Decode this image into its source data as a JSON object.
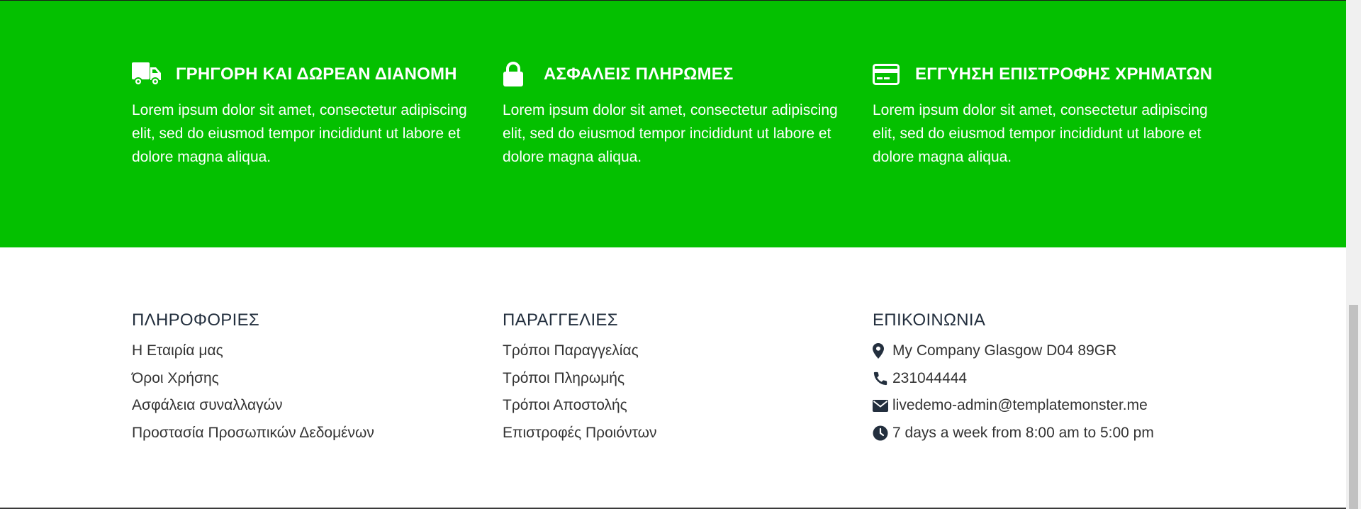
{
  "colors": {
    "features_bg": "#04c000",
    "footer_bg": "#ffffff",
    "text_dark": "#232f3e"
  },
  "features": [
    {
      "icon": "truck-icon",
      "title": "ΓΡΗΓΟΡΗ ΚΑΙ ΔΩΡΕΑΝ ΔΙΑΝΟΜΗ",
      "text": "Lorem ipsum dolor sit amet, consectetur adipiscing elit, sed do eiusmod tempor incididunt ut labore et dolore magna aliqua."
    },
    {
      "icon": "lock-icon",
      "title": "ΑΣΦΑΛΕΙΣ ΠΛΗΡΩΜΕΣ",
      "text": "Lorem ipsum dolor sit amet, consectetur adipiscing elit, sed do eiusmod tempor incididunt ut labore et dolore magna aliqua."
    },
    {
      "icon": "credit-card-icon",
      "title": "ΕΓΓΥΗΣΗ ΕΠΙΣΤΡΟΦΗΣ ΧΡΗΜΑΤΩΝ",
      "text": "Lorem ipsum dolor sit amet, consectetur adipiscing elit, sed do eiusmod tempor incididunt ut labore et dolore magna aliqua."
    }
  ],
  "footer": {
    "info": {
      "title": "ΠΛΗΡΟΦΟΡΙΕΣ",
      "links": [
        "Η Εταιρία μας",
        "Όροι Χρήσης",
        "Ασφάλεια συναλλαγών",
        "Προστασία Προσωπικών Δεδομένων"
      ]
    },
    "orders": {
      "title": "ΠΑΡΑΓΓΕΛΙΕΣ",
      "links": [
        "Τρόποι Παραγγελίας",
        "Τρόποι Πληρωμής",
        "Τρόποι Αποστολής",
        "Επιστροφές Προιόντων"
      ]
    },
    "contact": {
      "title": "ΕΠΙΚΟΙΝΩΝΙΑ",
      "items": [
        {
          "icon": "map-marker-icon",
          "text": "My Company Glasgow D04 89GR"
        },
        {
          "icon": "phone-icon",
          "text": "231044444"
        },
        {
          "icon": "envelope-icon",
          "text": "livedemo-admin@templatemonster.me"
        },
        {
          "icon": "clock-icon",
          "text": "7 days a week from 8:00 am to 5:00 pm"
        }
      ]
    }
  }
}
